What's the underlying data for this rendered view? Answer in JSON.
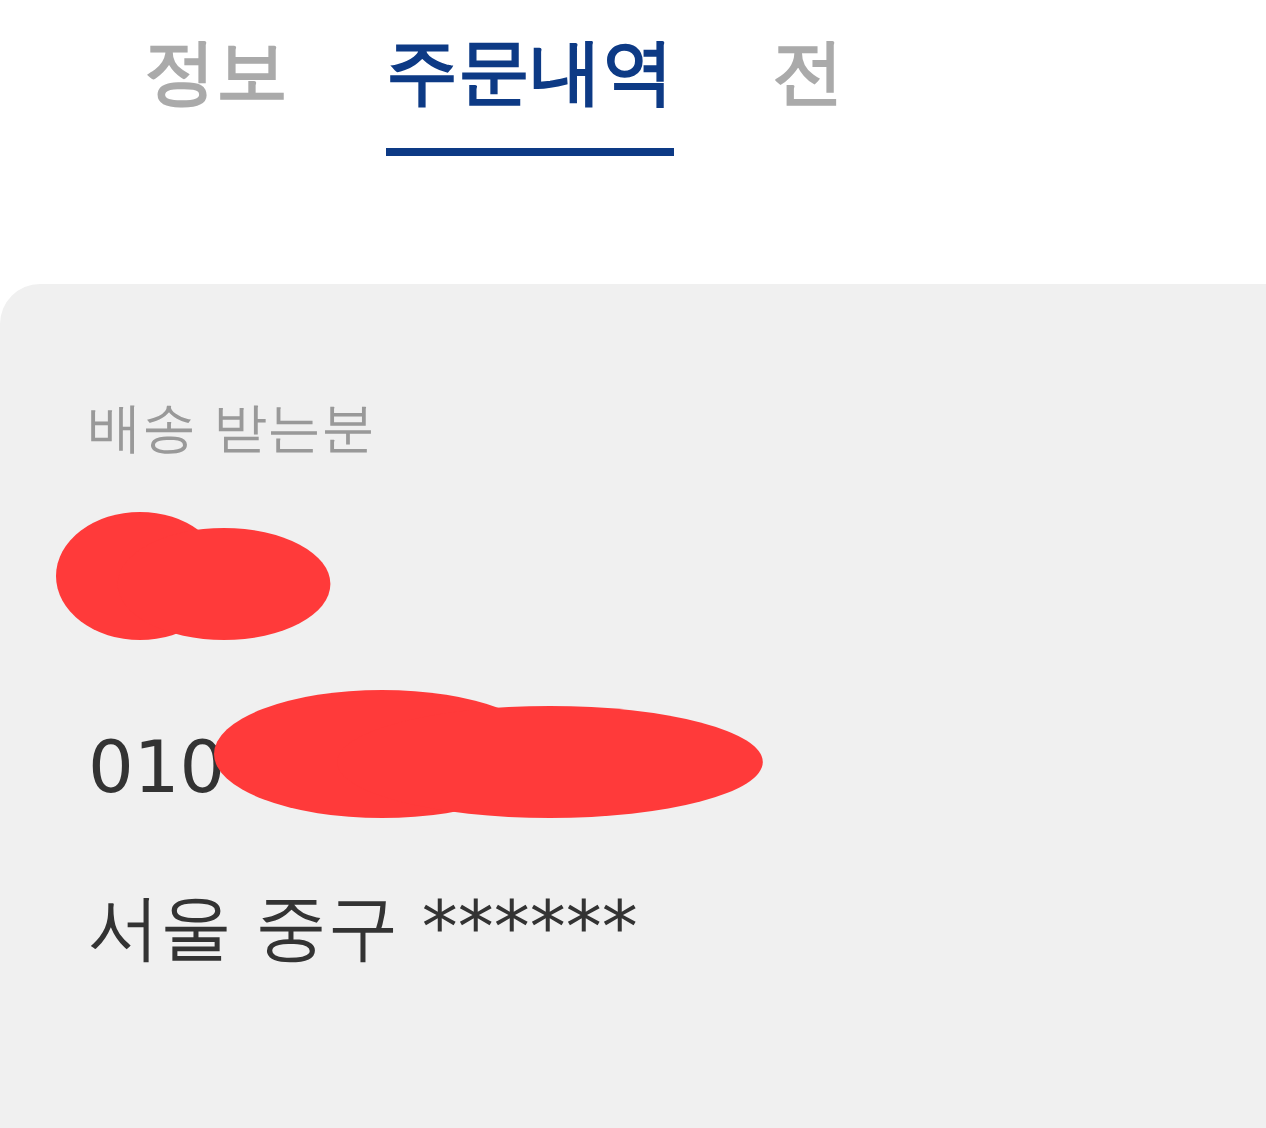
{
  "tabs": [
    {
      "label": "정보",
      "selected": false
    },
    {
      "label": "주문내역",
      "selected": true
    },
    {
      "label": "전",
      "selected": false
    }
  ],
  "recipient": {
    "label": "배송 받는분",
    "name": {
      "redacted": true
    },
    "phone": {
      "text": "010",
      "redacted": true
    },
    "address": "서울 중구 ******"
  }
}
